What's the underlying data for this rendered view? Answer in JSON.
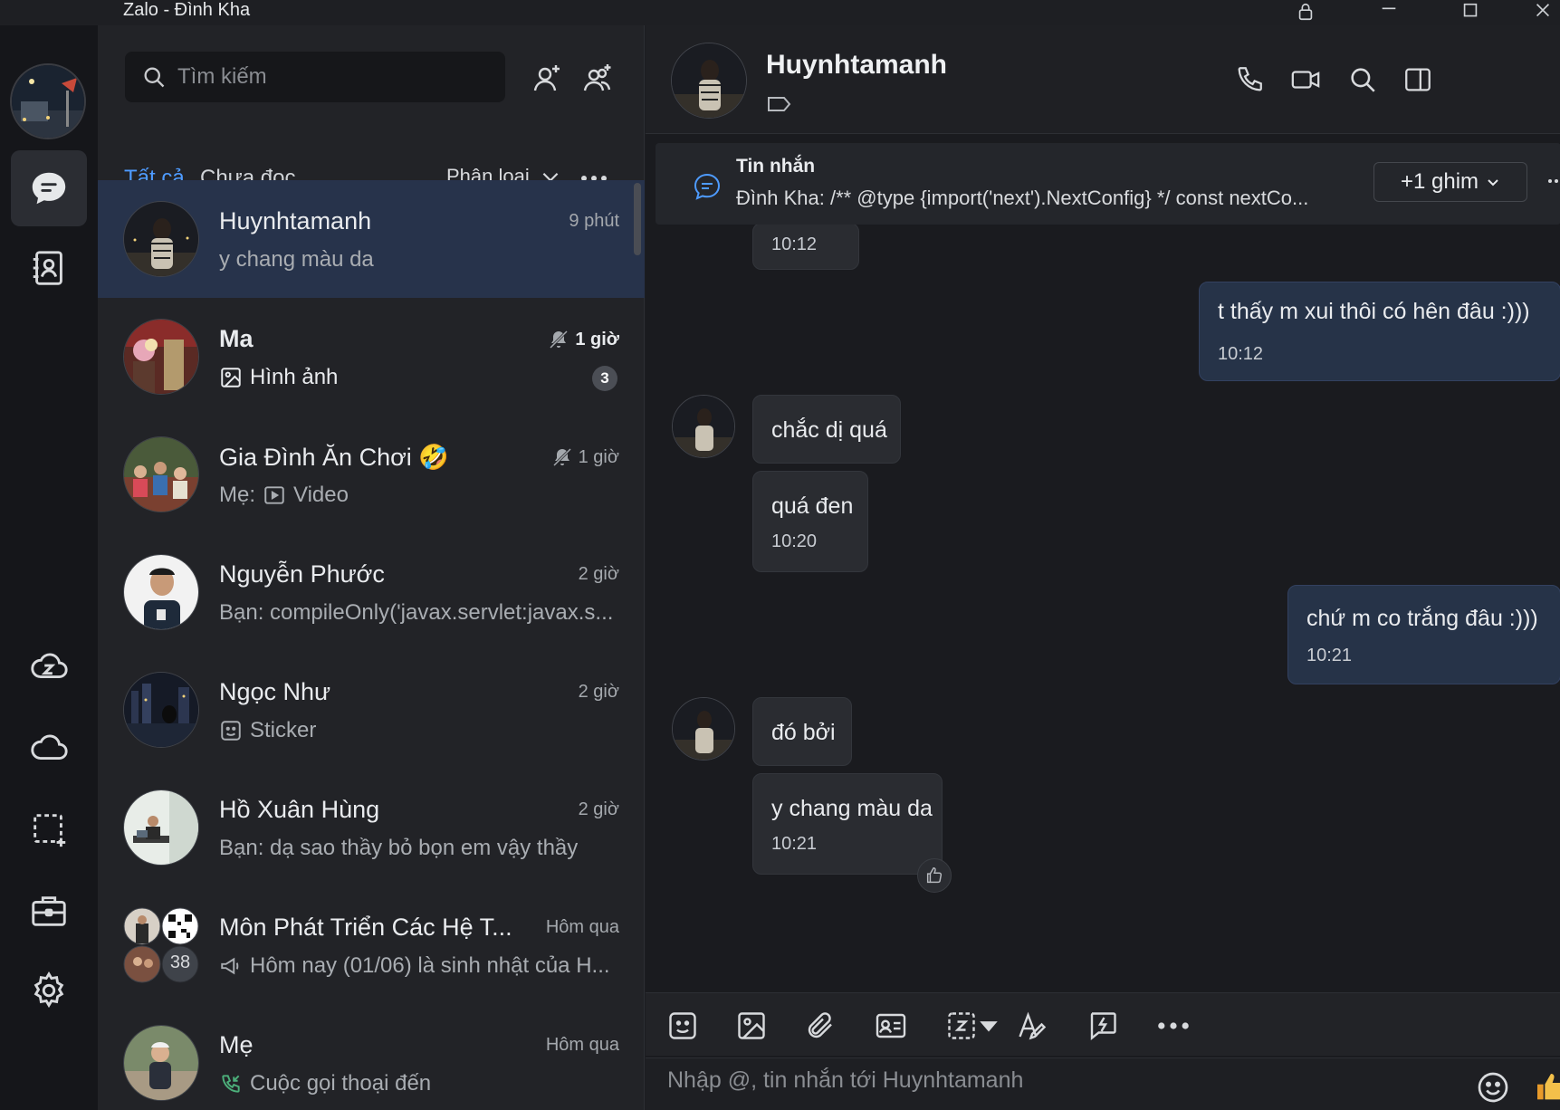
{
  "window": {
    "title": "Zalo - Đình Kha"
  },
  "search": {
    "placeholder": "Tìm kiếm"
  },
  "tabs": {
    "all": "Tất cả",
    "unread": "Chưa đọc",
    "filter": "Phân loại"
  },
  "conversations": [
    {
      "name": "Huynhtamanh",
      "time": "9 phút",
      "preview": "y chang màu da",
      "selected": true
    },
    {
      "name": "Ma",
      "time": "1 giờ",
      "preview": "Hình ảnh",
      "badge": "3",
      "muted": true,
      "unread": true
    },
    {
      "name": "Gia Đình Ăn Chơi 🤣",
      "time": "1 giờ",
      "preview_prefix": "Mẹ:",
      "preview": "Video",
      "muted": true
    },
    {
      "name": "Nguyễn Phước",
      "time": "2 giờ",
      "preview": "Bạn: compileOnly('javax.servlet:javax.s..."
    },
    {
      "name": "Ngọc Như",
      "time": "2 giờ",
      "preview": "Sticker"
    },
    {
      "name": "Hồ Xuân Hùng",
      "time": "2 giờ",
      "preview": "Bạn: dạ sao thầy bỏ bọn em vậy thầy"
    },
    {
      "name": "Môn Phát Triển Các Hệ T...",
      "time": "Hôm qua",
      "preview": "Hôm nay (01/06) là sinh nhật của H...",
      "member_count": "38"
    },
    {
      "name": "Mẹ",
      "time": "Hôm qua",
      "preview": "Cuộc gọi thoại đến"
    }
  ],
  "chat": {
    "name": "Huynhtamanh",
    "pinned": {
      "title": "Tin nhắn",
      "text": "Đình Kha: /** @type {import('next').NextConfig} */ const nextCo...",
      "more": "+1 ghim"
    },
    "messages": [
      {
        "from": "them",
        "time": "10:12"
      },
      {
        "from": "me",
        "text": "t thấy m xui thôi có hên đâu :)))",
        "time": "10:12"
      },
      {
        "from": "them",
        "text": "chắc dị quá"
      },
      {
        "from": "them",
        "text": "quá đen",
        "time": "10:20"
      },
      {
        "from": "me",
        "text": "chứ m co trắng đâu :)))",
        "time": "10:21"
      },
      {
        "from": "them",
        "text": "đó bởi"
      },
      {
        "from": "them",
        "text": "y chang màu da",
        "time": "10:21"
      }
    ],
    "composer_placeholder": "Nhập @, tin nhắn tới Huynhtamanh"
  },
  "colors": {
    "accent": "#4e9bff",
    "selected_row": "#27334b",
    "outgoing_bubble": "#263348"
  }
}
